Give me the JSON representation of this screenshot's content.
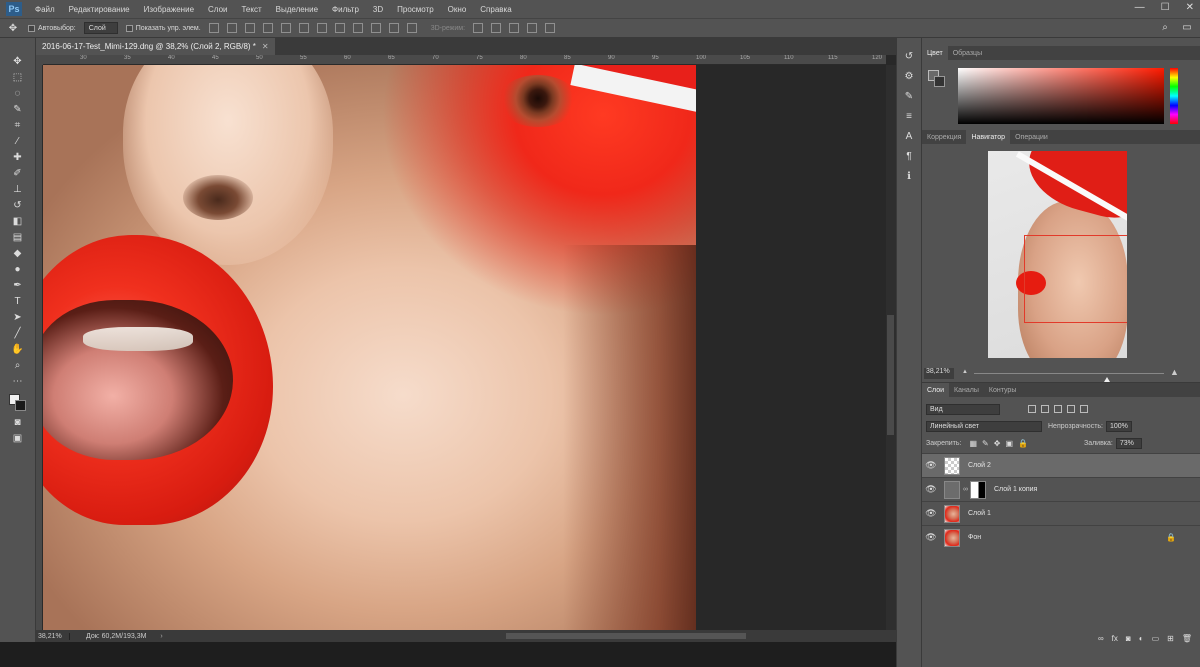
{
  "app": {
    "logo": "Ps"
  },
  "menu": [
    "Файл",
    "Редактирование",
    "Изображение",
    "Слои",
    "Текст",
    "Выделение",
    "Фильтр",
    "3D",
    "Просмотр",
    "Окно",
    "Справка"
  ],
  "window_controls": {
    "minimize": "—",
    "maximize": "☐",
    "close": "✕"
  },
  "options": {
    "autoselect_label": "Автовыбор:",
    "autoselect_value": "Слой",
    "show_controls_label": "Показать упр. элем.",
    "mode_3d": "3D-режим:"
  },
  "document": {
    "tab_title": "2016-06-17-Test_Mimi-129.dng @ 38,2% (Слой 2, RGB/8) *",
    "tab_close": "✕",
    "zoom": "38,21%",
    "doc_info": "Док: 60,2M/193,3M"
  },
  "ruler_ticks": [
    "30",
    "35",
    "40",
    "45",
    "50",
    "55",
    "60",
    "65",
    "70",
    "75",
    "80",
    "85",
    "90",
    "95",
    "100",
    "105",
    "110",
    "115",
    "120"
  ],
  "tools": [
    "move-icon",
    "marquee-icon",
    "lasso-icon",
    "quick-select-icon",
    "crop-icon",
    "eyedropper-icon",
    "healing-icon",
    "brush-icon",
    "stamp-icon",
    "history-brush-icon",
    "eraser-icon",
    "gradient-icon",
    "blur-icon",
    "dodge-icon",
    "pen-icon",
    "type-icon",
    "path-select-icon",
    "shape-icon",
    "hand-icon",
    "zoom-icon",
    "more-icon"
  ],
  "color_panel": {
    "tabs": [
      "Цвет",
      "Образцы"
    ],
    "active": 0
  },
  "navigator_panel": {
    "tabs": [
      "Коррекция",
      "Навигатор",
      "Операции"
    ],
    "active": 1,
    "zoom": "38,21%",
    "zoom_fraction": 0.65
  },
  "layers_panel": {
    "tabs": [
      "Слои",
      "Каналы",
      "Контуры"
    ],
    "active": 0,
    "filter_kind": "Вид",
    "blend_mode": "Линейный свет",
    "opacity_label": "Непрозрачность:",
    "opacity_value": "100%",
    "lock_label": "Закрепить:",
    "fill_label": "Заливка:",
    "fill_value": "73%",
    "layers": [
      {
        "name": "Слой 2",
        "selected": true,
        "visible": true,
        "thumb": "transparent"
      },
      {
        "name": "Слой 1 копия",
        "selected": false,
        "visible": true,
        "thumb": "gray-with-mask"
      },
      {
        "name": "Слой 1",
        "selected": false,
        "visible": true,
        "thumb": "photo"
      },
      {
        "name": "Фон",
        "selected": false,
        "visible": true,
        "thumb": "photo",
        "locked": true
      }
    ]
  },
  "colors": {
    "accent_red": "#e8201a",
    "panel_bg": "#535353",
    "canvas_bg": "#282828"
  }
}
